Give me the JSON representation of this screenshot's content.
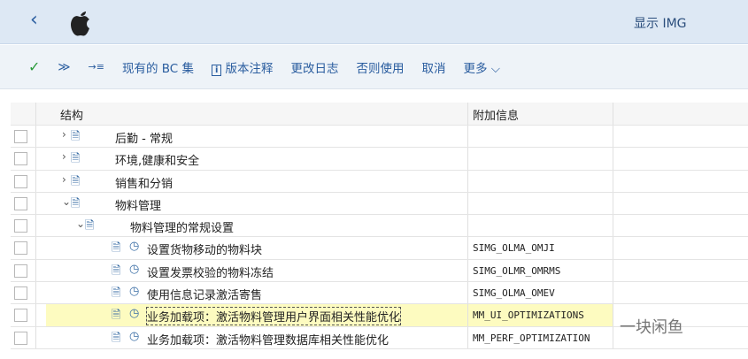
{
  "header": {
    "title": "显示 IMG",
    "back_icon": "chevron-left-icon",
    "logo": "apple-logo"
  },
  "toolbar": {
    "items": [
      "现有的 BC 集",
      "版本注释",
      "更改日志",
      "否则使用",
      "取消",
      "更多"
    ]
  },
  "table": {
    "columns": [
      "结构",
      "附加信息"
    ],
    "rows": [
      {
        "label": "后勤 - 常规",
        "info": "",
        "level": 0,
        "expand": "›"
      },
      {
        "label": "环境,健康和安全",
        "info": "",
        "level": 0,
        "expand": "›"
      },
      {
        "label": "销售和分销",
        "info": "",
        "level": 0,
        "expand": "›"
      },
      {
        "label": "物料管理",
        "info": "",
        "level": 0,
        "expand": "⌄"
      },
      {
        "label": "物料管理的常规设置",
        "info": "",
        "level": 1,
        "expand": "⌄"
      },
      {
        "label": "设置货物移动的物料块",
        "info": "SIMG_OLMA_OMJI",
        "level": 2
      },
      {
        "label": "设置发票校验的物料冻结",
        "info": "SIMG_OLMR_OMRMS",
        "level": 2
      },
      {
        "label": "使用信息记录激活寄售",
        "info": "SIMG_OLMA_OMEV",
        "level": 2
      },
      {
        "label": "业务加载项：激活物料管理用户界面相关性能优化",
        "info": "MM_UI_OPTIMIZATIONS",
        "level": 2,
        "selected": true
      },
      {
        "label": "业务加载项：激活物料管理数据库相关性能优化",
        "info": "MM_PERF_OPTIMIZATION",
        "level": 2
      }
    ]
  },
  "watermark": "一块闲鱼"
}
